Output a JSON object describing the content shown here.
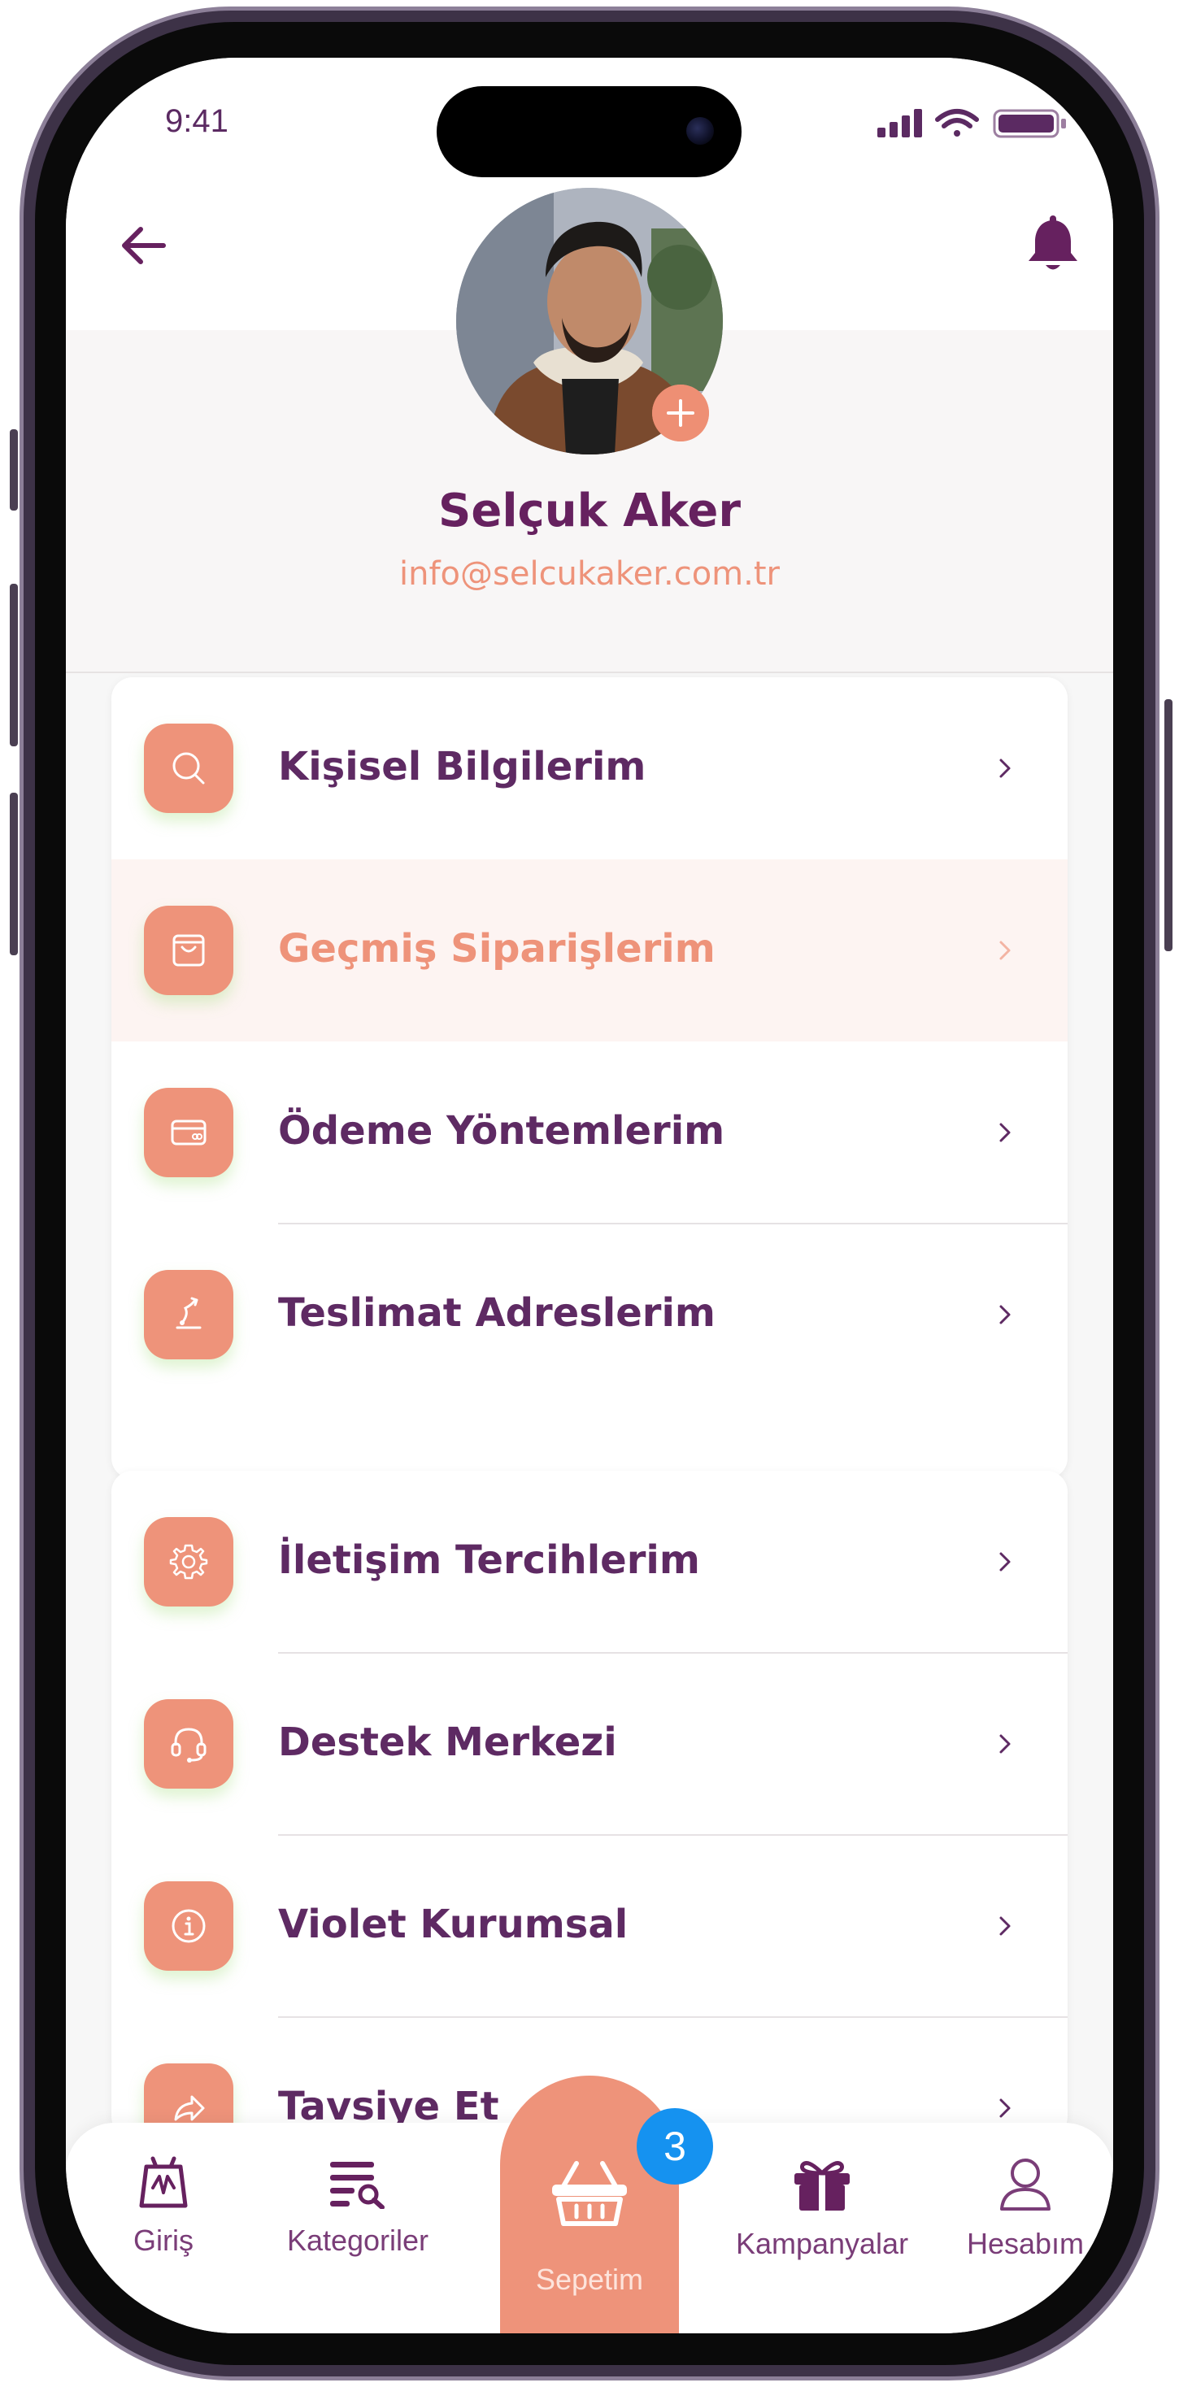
{
  "status_bar": {
    "time": "9:41"
  },
  "profile": {
    "name": "Selçuk Aker",
    "email": "info@selcukaker.com.tr"
  },
  "menu_group_1": [
    {
      "label": "Kişisel Bilgilerim",
      "icon": "search-icon"
    },
    {
      "label": "Geçmiş Siparişlerim",
      "icon": "shopping-bag-icon",
      "active": true
    },
    {
      "label": "Ödeme Yöntemlerim",
      "icon": "credit-card-icon"
    },
    {
      "label": "Teslimat Adreslerim",
      "icon": "delivery-location-icon"
    }
  ],
  "menu_group_2": [
    {
      "label": "İletişim Tercihlerim",
      "icon": "gear-icon"
    },
    {
      "label": "Destek Merkezi",
      "icon": "headset-icon"
    },
    {
      "label": "Violet Kurumsal",
      "icon": "info-icon"
    },
    {
      "label": "Tavsiye Et",
      "icon": "share-icon"
    }
  ],
  "bottom_nav": {
    "home": "Giriş",
    "categories": "Kategoriler",
    "cart": "Sepetim",
    "cart_count": "3",
    "campaigns": "Kampanyalar",
    "account": "Hesabım"
  },
  "colors": {
    "brand_purple": "#66215f",
    "accent_salmon": "#ee937a",
    "badge_blue": "#1592f0"
  }
}
